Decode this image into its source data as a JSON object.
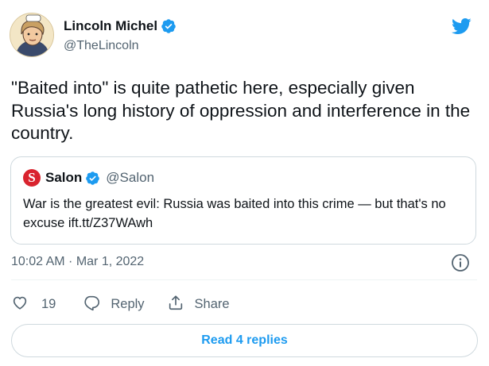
{
  "author": {
    "name": "Lincoln Michel",
    "handle": "@TheLincoln",
    "avatar_icon": "avatar-lincoln",
    "verified": true
  },
  "tweet": {
    "text": "\"Baited into\" is quite pathetic here, especially given Russia's long history of oppression and interference in the country.",
    "timestamp": "10:02 AM · Mar 1, 2022"
  },
  "quoted": {
    "logo_letter": "S",
    "name": "Salon",
    "handle": "@Salon",
    "verified": true,
    "text": "War is the greatest evil: Russia was baited into this crime — but that's no excuse ift.tt/Z37WAwh"
  },
  "actions": {
    "like_count": "19",
    "reply_label": "Reply",
    "share_label": "Share"
  },
  "replies_button": "Read 4 replies",
  "colors": {
    "accent": "#1d9bf0",
    "salon_red": "#d9232e",
    "text_primary": "#0f1419",
    "text_secondary": "#536471",
    "border": "#cfd9de"
  },
  "icons": [
    "twitter-bird-icon",
    "verified-badge-icon",
    "info-icon",
    "heart-icon",
    "reply-bubble-icon",
    "share-icon"
  ]
}
